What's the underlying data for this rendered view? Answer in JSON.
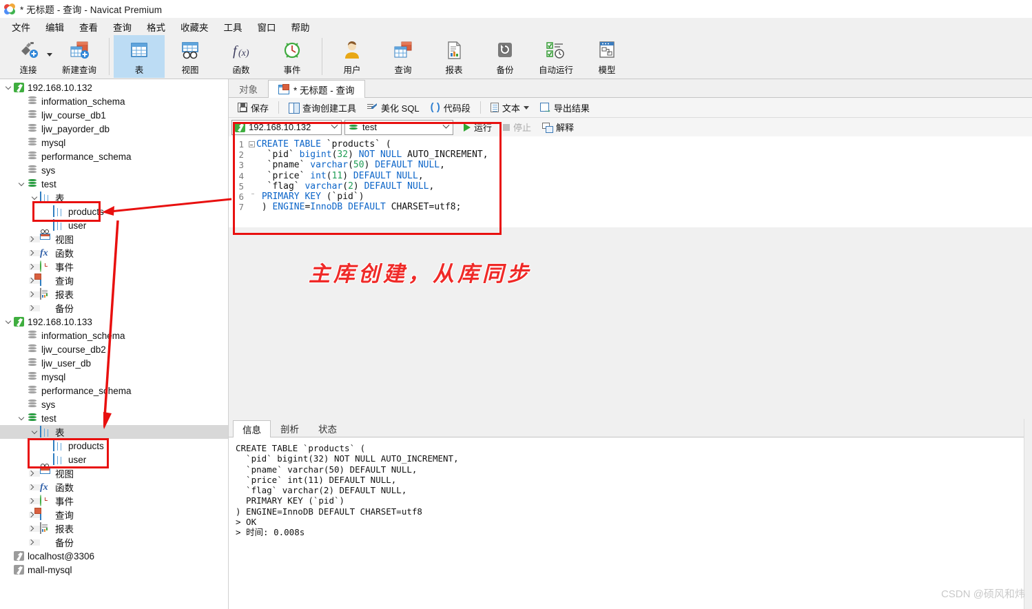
{
  "window": {
    "title": "* 无标题 - 查询 - Navicat Premium",
    "logo_icon": "navicat-logo-icon"
  },
  "menubar": {
    "items": [
      "文件",
      "编辑",
      "查看",
      "查询",
      "格式",
      "收藏夹",
      "工具",
      "窗口",
      "帮助"
    ]
  },
  "toolbar": {
    "items": [
      {
        "label": "连接",
        "icon": "connection-icon",
        "active": false,
        "has_caret": true
      },
      {
        "label": "新建查询",
        "icon": "new-query-icon",
        "active": false,
        "has_caret": false
      },
      {
        "label": "表",
        "icon": "table-icon",
        "active": true,
        "has_caret": false
      },
      {
        "label": "视图",
        "icon": "view-icon",
        "active": false,
        "has_caret": false
      },
      {
        "label": "函数",
        "icon": "function-icon",
        "active": false,
        "has_caret": false
      },
      {
        "label": "事件",
        "icon": "event-icon",
        "active": false,
        "has_caret": false
      },
      {
        "label": "用户",
        "icon": "user-icon",
        "active": false,
        "has_caret": false
      },
      {
        "label": "查询",
        "icon": "query-icon",
        "active": false,
        "has_caret": false
      },
      {
        "label": "报表",
        "icon": "report-icon",
        "active": false,
        "has_caret": false
      },
      {
        "label": "备份",
        "icon": "backup-icon",
        "active": false,
        "has_caret": false
      },
      {
        "label": "自动运行",
        "icon": "automation-icon",
        "active": false,
        "has_caret": false
      },
      {
        "label": "模型",
        "icon": "model-icon",
        "active": false,
        "has_caret": false
      }
    ]
  },
  "sidebar": {
    "nodes": [
      {
        "depth": 0,
        "label": "192.168.10.132",
        "icon": "server-icon",
        "state": "open",
        "status": "connected"
      },
      {
        "depth": 1,
        "label": "information_schema",
        "icon": "database-icon",
        "state": "leaf",
        "status": "closed"
      },
      {
        "depth": 1,
        "label": "ljw_course_db1",
        "icon": "database-icon",
        "state": "leaf",
        "status": "closed"
      },
      {
        "depth": 1,
        "label": "ljw_payorder_db",
        "icon": "database-icon",
        "state": "leaf",
        "status": "closed"
      },
      {
        "depth": 1,
        "label": "mysql",
        "icon": "database-icon",
        "state": "leaf",
        "status": "closed"
      },
      {
        "depth": 1,
        "label": "performance_schema",
        "icon": "database-icon",
        "state": "leaf",
        "status": "closed"
      },
      {
        "depth": 1,
        "label": "sys",
        "icon": "database-icon",
        "state": "leaf",
        "status": "closed"
      },
      {
        "depth": 1,
        "label": "test",
        "icon": "database-icon",
        "state": "open",
        "status": "open"
      },
      {
        "depth": 2,
        "label": "表",
        "icon": "table-folder-icon",
        "state": "open",
        "status": ""
      },
      {
        "depth": 3,
        "label": "products",
        "icon": "table-icon",
        "state": "leaf",
        "status": ""
      },
      {
        "depth": 3,
        "label": "user",
        "icon": "table-icon",
        "state": "leaf",
        "status": ""
      },
      {
        "depth": 2,
        "label": "视图",
        "icon": "view-folder-icon",
        "state": "closed",
        "status": ""
      },
      {
        "depth": 2,
        "label": "函数",
        "icon": "function-folder-icon",
        "state": "closed",
        "status": ""
      },
      {
        "depth": 2,
        "label": "事件",
        "icon": "event-folder-icon",
        "state": "closed",
        "status": ""
      },
      {
        "depth": 2,
        "label": "查询",
        "icon": "query-folder-icon",
        "state": "closed",
        "status": ""
      },
      {
        "depth": 2,
        "label": "报表",
        "icon": "report-folder-icon",
        "state": "closed",
        "status": ""
      },
      {
        "depth": 2,
        "label": "备份",
        "icon": "backup-folder-icon",
        "state": "closed",
        "status": ""
      },
      {
        "depth": 0,
        "label": "192.168.10.133",
        "icon": "server-icon",
        "state": "open",
        "status": "connected"
      },
      {
        "depth": 1,
        "label": "information_schema",
        "icon": "database-icon",
        "state": "leaf",
        "status": "closed"
      },
      {
        "depth": 1,
        "label": "ljw_course_db2",
        "icon": "database-icon",
        "state": "leaf",
        "status": "closed"
      },
      {
        "depth": 1,
        "label": "ljw_user_db",
        "icon": "database-icon",
        "state": "leaf",
        "status": "closed"
      },
      {
        "depth": 1,
        "label": "mysql",
        "icon": "database-icon",
        "state": "leaf",
        "status": "closed"
      },
      {
        "depth": 1,
        "label": "performance_schema",
        "icon": "database-icon",
        "state": "leaf",
        "status": "closed"
      },
      {
        "depth": 1,
        "label": "sys",
        "icon": "database-icon",
        "state": "leaf",
        "status": "closed"
      },
      {
        "depth": 1,
        "label": "test",
        "icon": "database-icon",
        "state": "open",
        "status": "open"
      },
      {
        "depth": 2,
        "label": "表",
        "icon": "table-folder-icon",
        "state": "open",
        "status": "",
        "selected": true
      },
      {
        "depth": 3,
        "label": "products",
        "icon": "table-icon",
        "state": "leaf",
        "status": ""
      },
      {
        "depth": 3,
        "label": "user",
        "icon": "table-icon",
        "state": "leaf",
        "status": ""
      },
      {
        "depth": 2,
        "label": "视图",
        "icon": "view-folder-icon",
        "state": "closed",
        "status": ""
      },
      {
        "depth": 2,
        "label": "函数",
        "icon": "function-folder-icon",
        "state": "closed",
        "status": ""
      },
      {
        "depth": 2,
        "label": "事件",
        "icon": "event-folder-icon",
        "state": "closed",
        "status": ""
      },
      {
        "depth": 2,
        "label": "查询",
        "icon": "query-folder-icon",
        "state": "closed",
        "status": ""
      },
      {
        "depth": 2,
        "label": "报表",
        "icon": "report-folder-icon",
        "state": "closed",
        "status": ""
      },
      {
        "depth": 2,
        "label": "备份",
        "icon": "backup-folder-icon",
        "state": "closed",
        "status": ""
      },
      {
        "depth": 0,
        "label": "localhost@3306",
        "icon": "server-icon",
        "state": "leaf",
        "status": "disconnected"
      },
      {
        "depth": 0,
        "label": "mall-mysql",
        "icon": "server-icon",
        "state": "leaf",
        "status": "disconnected"
      }
    ]
  },
  "editor_tabs": [
    {
      "label": "对象",
      "active": false,
      "icon": ""
    },
    {
      "label": "* 无标题 - 查询",
      "active": true,
      "icon": "query-icon"
    }
  ],
  "editor_toolbar": {
    "buttons": [
      {
        "label": "保存",
        "icon": "save-icon",
        "disabled": false,
        "caret": false
      },
      {
        "label": "查询创建工具",
        "icon": "query-builder-icon",
        "disabled": false,
        "caret": false
      },
      {
        "label": "美化 SQL",
        "icon": "beautify-icon",
        "disabled": false,
        "caret": false
      },
      {
        "label": "代码段",
        "icon": "snippet-icon",
        "disabled": false,
        "caret": false
      },
      {
        "label": "文本",
        "icon": "text-icon",
        "disabled": false,
        "caret": true
      },
      {
        "label": "导出结果",
        "icon": "export-icon",
        "disabled": false,
        "caret": false
      }
    ]
  },
  "selectors": {
    "connection": {
      "value": "192.168.10.132",
      "icon": "server-icon"
    },
    "database": {
      "value": "test",
      "icon": "database-icon"
    },
    "run": {
      "label": "运行",
      "icon": "play-icon",
      "disabled": false
    },
    "stop": {
      "label": "停止",
      "icon": "stop-icon",
      "disabled": true
    },
    "explain": {
      "label": "解释",
      "icon": "explain-icon",
      "disabled": false
    }
  },
  "sql_editor": {
    "lines": [
      {
        "n": "1",
        "fold": "start",
        "segs": [
          {
            "t": "CREATE TABLE ",
            "c": "kw"
          },
          {
            "t": "`products` (",
            "c": "idq"
          }
        ]
      },
      {
        "n": "2",
        "fold": "mid",
        "segs": [
          {
            "t": "  `pid` ",
            "c": "idq"
          },
          {
            "t": "bigint",
            "c": "kw"
          },
          {
            "t": "(",
            "c": "idq"
          },
          {
            "t": "32",
            "c": "num"
          },
          {
            "t": ") ",
            "c": "idq"
          },
          {
            "t": "NOT NULL",
            "c": "kw"
          },
          {
            "t": " AUTO_INCREMENT,",
            "c": "idq"
          }
        ]
      },
      {
        "n": "3",
        "fold": "mid",
        "segs": [
          {
            "t": "  `pname` ",
            "c": "idq"
          },
          {
            "t": "varchar",
            "c": "kw"
          },
          {
            "t": "(",
            "c": "idq"
          },
          {
            "t": "50",
            "c": "num"
          },
          {
            "t": ") ",
            "c": "idq"
          },
          {
            "t": "DEFAULT NULL",
            "c": "kw"
          },
          {
            "t": ",",
            "c": "idq"
          }
        ]
      },
      {
        "n": "4",
        "fold": "mid",
        "segs": [
          {
            "t": "  `price` ",
            "c": "idq"
          },
          {
            "t": "int",
            "c": "kw"
          },
          {
            "t": "(",
            "c": "idq"
          },
          {
            "t": "11",
            "c": "num"
          },
          {
            "t": ") ",
            "c": "idq"
          },
          {
            "t": "DEFAULT NULL",
            "c": "kw"
          },
          {
            "t": ",",
            "c": "idq"
          }
        ]
      },
      {
        "n": "5",
        "fold": "mid",
        "segs": [
          {
            "t": "  `flag` ",
            "c": "idq"
          },
          {
            "t": "varchar",
            "c": "kw"
          },
          {
            "t": "(",
            "c": "idq"
          },
          {
            "t": "2",
            "c": "num"
          },
          {
            "t": ") ",
            "c": "idq"
          },
          {
            "t": "DEFAULT NULL",
            "c": "kw"
          },
          {
            "t": ",",
            "c": "idq"
          }
        ]
      },
      {
        "n": "6",
        "fold": "end",
        "segs": [
          {
            "t": " PRIMARY KEY",
            "c": "kw"
          },
          {
            "t": " (`pid`)",
            "c": "idq"
          }
        ]
      },
      {
        "n": "7",
        "fold": "none",
        "segs": [
          {
            "t": " ) ",
            "c": "idq"
          },
          {
            "t": "ENGINE",
            "c": "kw"
          },
          {
            "t": "=",
            "c": "idq"
          },
          {
            "t": "InnoDB ",
            "c": "kw"
          },
          {
            "t": "DEFAULT",
            "c": "kw"
          },
          {
            "t": " CHARSET=utf8;",
            "c": "idq"
          }
        ]
      }
    ]
  },
  "result_tabs": [
    {
      "label": "信息",
      "active": true
    },
    {
      "label": "剖析",
      "active": false
    },
    {
      "label": "状态",
      "active": false
    }
  ],
  "result_output": "CREATE TABLE `products` (\n  `pid` bigint(32) NOT NULL AUTO_INCREMENT,\n  `pname` varchar(50) DEFAULT NULL,\n  `price` int(11) DEFAULT NULL,\n  `flag` varchar(2) DEFAULT NULL,\n  PRIMARY KEY (`pid`)\n) ENGINE=InnoDB DEFAULT CHARSET=utf8\n> OK\n> 时间: 0.008s",
  "annotations": {
    "note_text": "主库创建，从库同步",
    "accent_color": "#e8100f",
    "note_color": "#ef2a28"
  },
  "watermark": {
    "text": "CSDN @硕风和炜"
  }
}
